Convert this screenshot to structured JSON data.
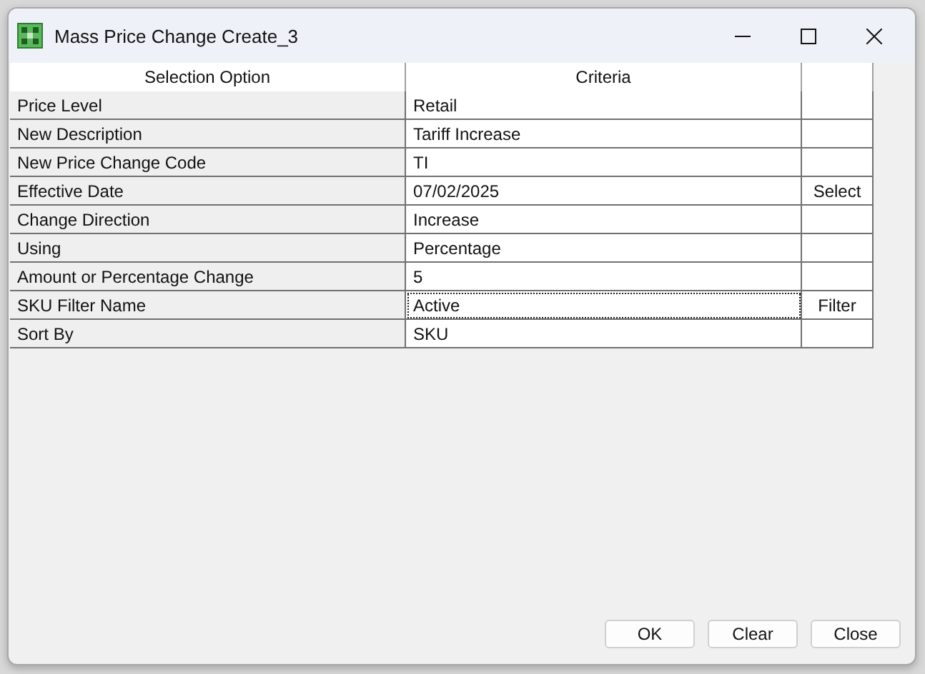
{
  "window": {
    "title": "Mass Price Change Create_3"
  },
  "table": {
    "columns": [
      "Selection Option",
      "Criteria"
    ],
    "rows": [
      {
        "option": "Price Level",
        "criteria": "Retail",
        "focused": false
      },
      {
        "option": "New Description",
        "criteria": "Tariff Increase",
        "focused": false
      },
      {
        "option": "New Price Change Code",
        "criteria": "TI",
        "focused": false
      },
      {
        "option": "Effective Date",
        "criteria": "07/02/2025",
        "action": "Select",
        "focused": false
      },
      {
        "option": "Change Direction",
        "criteria": "Increase",
        "focused": false
      },
      {
        "option": "Using",
        "criteria": "Percentage",
        "focused": false
      },
      {
        "option": "Amount or Percentage Change",
        "criteria": "5",
        "focused": false
      },
      {
        "option": "SKU Filter Name",
        "criteria": "Active",
        "action": "Filter",
        "focused": true
      },
      {
        "option": "Sort By",
        "criteria": "SKU",
        "focused": false
      }
    ]
  },
  "buttons": [
    "OK",
    "Clear",
    "Close"
  ]
}
